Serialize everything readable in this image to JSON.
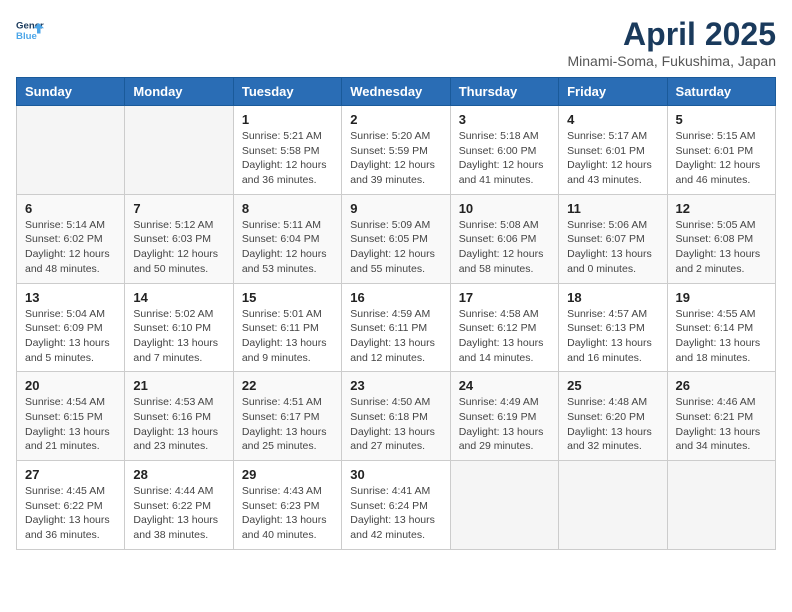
{
  "logo": {
    "text_general": "General",
    "text_blue": "Blue"
  },
  "title": "April 2025",
  "location": "Minami-Soma, Fukushima, Japan",
  "weekdays": [
    "Sunday",
    "Monday",
    "Tuesday",
    "Wednesday",
    "Thursday",
    "Friday",
    "Saturday"
  ],
  "weeks": [
    [
      {
        "day": "",
        "info": ""
      },
      {
        "day": "",
        "info": ""
      },
      {
        "day": "1",
        "info": "Sunrise: 5:21 AM\nSunset: 5:58 PM\nDaylight: 12 hours and 36 minutes."
      },
      {
        "day": "2",
        "info": "Sunrise: 5:20 AM\nSunset: 5:59 PM\nDaylight: 12 hours and 39 minutes."
      },
      {
        "day": "3",
        "info": "Sunrise: 5:18 AM\nSunset: 6:00 PM\nDaylight: 12 hours and 41 minutes."
      },
      {
        "day": "4",
        "info": "Sunrise: 5:17 AM\nSunset: 6:01 PM\nDaylight: 12 hours and 43 minutes."
      },
      {
        "day": "5",
        "info": "Sunrise: 5:15 AM\nSunset: 6:01 PM\nDaylight: 12 hours and 46 minutes."
      }
    ],
    [
      {
        "day": "6",
        "info": "Sunrise: 5:14 AM\nSunset: 6:02 PM\nDaylight: 12 hours and 48 minutes."
      },
      {
        "day": "7",
        "info": "Sunrise: 5:12 AM\nSunset: 6:03 PM\nDaylight: 12 hours and 50 minutes."
      },
      {
        "day": "8",
        "info": "Sunrise: 5:11 AM\nSunset: 6:04 PM\nDaylight: 12 hours and 53 minutes."
      },
      {
        "day": "9",
        "info": "Sunrise: 5:09 AM\nSunset: 6:05 PM\nDaylight: 12 hours and 55 minutes."
      },
      {
        "day": "10",
        "info": "Sunrise: 5:08 AM\nSunset: 6:06 PM\nDaylight: 12 hours and 58 minutes."
      },
      {
        "day": "11",
        "info": "Sunrise: 5:06 AM\nSunset: 6:07 PM\nDaylight: 13 hours and 0 minutes."
      },
      {
        "day": "12",
        "info": "Sunrise: 5:05 AM\nSunset: 6:08 PM\nDaylight: 13 hours and 2 minutes."
      }
    ],
    [
      {
        "day": "13",
        "info": "Sunrise: 5:04 AM\nSunset: 6:09 PM\nDaylight: 13 hours and 5 minutes."
      },
      {
        "day": "14",
        "info": "Sunrise: 5:02 AM\nSunset: 6:10 PM\nDaylight: 13 hours and 7 minutes."
      },
      {
        "day": "15",
        "info": "Sunrise: 5:01 AM\nSunset: 6:11 PM\nDaylight: 13 hours and 9 minutes."
      },
      {
        "day": "16",
        "info": "Sunrise: 4:59 AM\nSunset: 6:11 PM\nDaylight: 13 hours and 12 minutes."
      },
      {
        "day": "17",
        "info": "Sunrise: 4:58 AM\nSunset: 6:12 PM\nDaylight: 13 hours and 14 minutes."
      },
      {
        "day": "18",
        "info": "Sunrise: 4:57 AM\nSunset: 6:13 PM\nDaylight: 13 hours and 16 minutes."
      },
      {
        "day": "19",
        "info": "Sunrise: 4:55 AM\nSunset: 6:14 PM\nDaylight: 13 hours and 18 minutes."
      }
    ],
    [
      {
        "day": "20",
        "info": "Sunrise: 4:54 AM\nSunset: 6:15 PM\nDaylight: 13 hours and 21 minutes."
      },
      {
        "day": "21",
        "info": "Sunrise: 4:53 AM\nSunset: 6:16 PM\nDaylight: 13 hours and 23 minutes."
      },
      {
        "day": "22",
        "info": "Sunrise: 4:51 AM\nSunset: 6:17 PM\nDaylight: 13 hours and 25 minutes."
      },
      {
        "day": "23",
        "info": "Sunrise: 4:50 AM\nSunset: 6:18 PM\nDaylight: 13 hours and 27 minutes."
      },
      {
        "day": "24",
        "info": "Sunrise: 4:49 AM\nSunset: 6:19 PM\nDaylight: 13 hours and 29 minutes."
      },
      {
        "day": "25",
        "info": "Sunrise: 4:48 AM\nSunset: 6:20 PM\nDaylight: 13 hours and 32 minutes."
      },
      {
        "day": "26",
        "info": "Sunrise: 4:46 AM\nSunset: 6:21 PM\nDaylight: 13 hours and 34 minutes."
      }
    ],
    [
      {
        "day": "27",
        "info": "Sunrise: 4:45 AM\nSunset: 6:22 PM\nDaylight: 13 hours and 36 minutes."
      },
      {
        "day": "28",
        "info": "Sunrise: 4:44 AM\nSunset: 6:22 PM\nDaylight: 13 hours and 38 minutes."
      },
      {
        "day": "29",
        "info": "Sunrise: 4:43 AM\nSunset: 6:23 PM\nDaylight: 13 hours and 40 minutes."
      },
      {
        "day": "30",
        "info": "Sunrise: 4:41 AM\nSunset: 6:24 PM\nDaylight: 13 hours and 42 minutes."
      },
      {
        "day": "",
        "info": ""
      },
      {
        "day": "",
        "info": ""
      },
      {
        "day": "",
        "info": ""
      }
    ]
  ]
}
